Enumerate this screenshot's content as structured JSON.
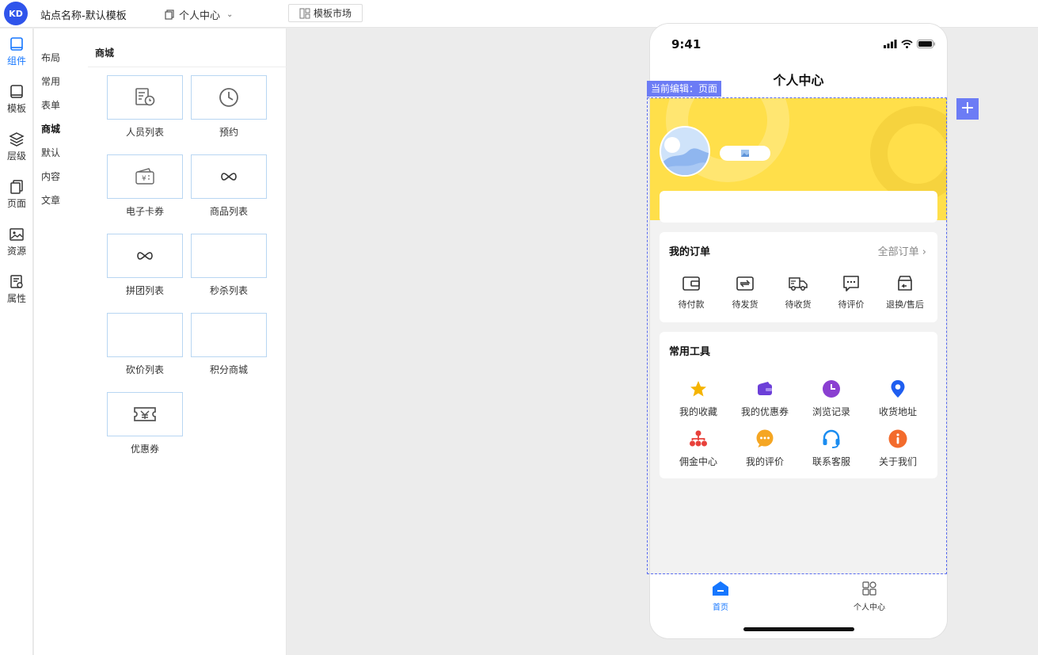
{
  "header": {
    "site_title": "站点名称-默认模板",
    "page_selector": "个人中心",
    "template_market": "模板市场"
  },
  "rail": [
    {
      "label": "组件",
      "icon": "book-icon",
      "active": true
    },
    {
      "label": "模板",
      "icon": "template-icon"
    },
    {
      "label": "层级",
      "icon": "layers-icon"
    },
    {
      "label": "页面",
      "icon": "pages-icon"
    },
    {
      "label": "资源",
      "icon": "image-icon"
    },
    {
      "label": "属性",
      "icon": "settings-doc-icon"
    }
  ],
  "categories": [
    "布局",
    "常用",
    "表单",
    "商城",
    "默认",
    "内容",
    "文章"
  ],
  "active_category": "商城",
  "panel": {
    "title": "商城",
    "components": [
      {
        "label": "人员列表",
        "icon": "person-list-icon"
      },
      {
        "label": "预约",
        "icon": "clock-icon"
      },
      {
        "label": "电子卡券",
        "icon": "wallet-icon"
      },
      {
        "label": "商品列表",
        "icon": "infinity-icon"
      },
      {
        "label": "拼团列表",
        "icon": "infinity-icon"
      },
      {
        "label": "秒杀列表",
        "icon": ""
      },
      {
        "label": "砍价列表",
        "icon": ""
      },
      {
        "label": "积分商城",
        "icon": ""
      },
      {
        "label": "优惠券",
        "icon": "coupon-icon"
      }
    ]
  },
  "phone": {
    "time": "9:41",
    "nav_title": "个人中心",
    "edit_tag": "当前编辑：页面",
    "orders": {
      "title": "我的订单",
      "more": "全部订单",
      "items": [
        "待付款",
        "待发货",
        "待收货",
        "待评价",
        "退换/售后"
      ]
    },
    "tools": {
      "title": "常用工具",
      "items": [
        {
          "label": "我的收藏",
          "color": "#f5b400"
        },
        {
          "label": "我的优惠券",
          "color": "#6c3fd8"
        },
        {
          "label": "浏览记录",
          "color": "#8a3fd1"
        },
        {
          "label": "收货地址",
          "color": "#1f5ef0"
        },
        {
          "label": "佣金中心",
          "color": "#e8413b"
        },
        {
          "label": "我的评价",
          "color": "#f5a623"
        },
        {
          "label": "联系客服",
          "color": "#1a8cf0"
        },
        {
          "label": "关于我们",
          "color": "#f36b2c"
        }
      ]
    },
    "tabbar": [
      {
        "label": "首页",
        "active": true,
        "color": "#1677ff"
      },
      {
        "label": "个人中心",
        "active": false,
        "color": "#333333"
      }
    ]
  }
}
